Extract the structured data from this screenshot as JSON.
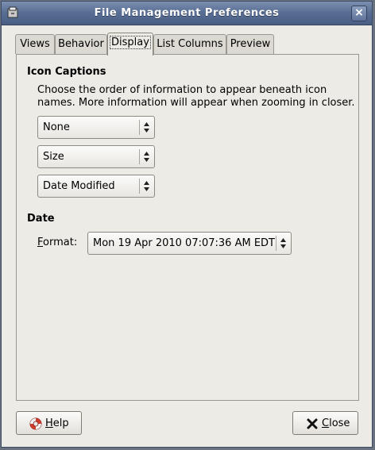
{
  "window": {
    "title": "File Management Preferences"
  },
  "tabs": [
    {
      "label": "Views"
    },
    {
      "label": "Behavior"
    },
    {
      "label": "Display"
    },
    {
      "label": "List Columns"
    },
    {
      "label": "Preview"
    }
  ],
  "icon_captions": {
    "title": "Icon Captions",
    "description": "Choose the order of information to appear beneath icon names. More information will appear when zooming in closer.",
    "combos": [
      {
        "value": "None"
      },
      {
        "value": "Size"
      },
      {
        "value": "Date Modified"
      }
    ]
  },
  "date": {
    "title": "Date",
    "format_label_mnemonic": "F",
    "format_label_rest": "ormat:",
    "format_value": "Mon 19 Apr 2010 07:07:36 AM EDT"
  },
  "buttons": {
    "help_mnemonic": "H",
    "help_rest": "elp",
    "close_mnemonic": "C",
    "close_rest": "lose"
  }
}
